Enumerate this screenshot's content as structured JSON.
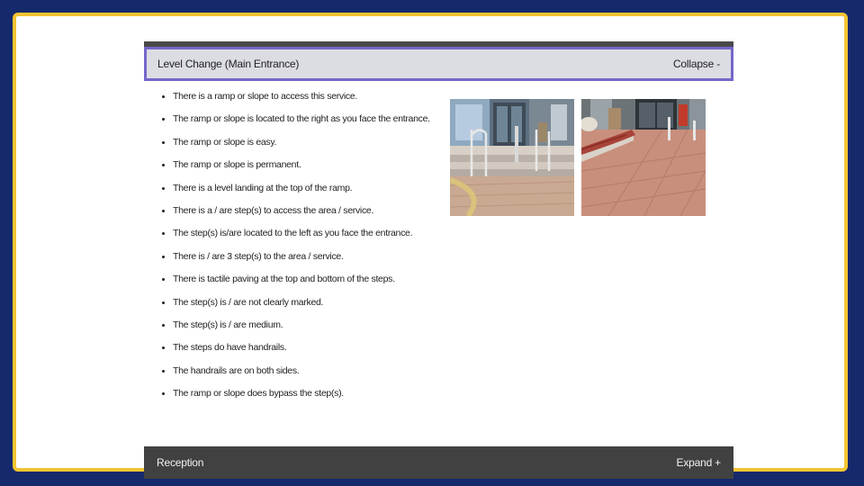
{
  "level_change": {
    "title": "Level Change (Main Entrance)",
    "toggle_label": "Collapse -",
    "items": [
      "There is a ramp or slope to access this service.",
      "The ramp or slope is located to the right as you face the entrance.",
      "The ramp or slope is easy.",
      "The ramp or slope is permanent.",
      "There is a level landing at the top of the ramp.",
      "There is a / are step(s) to access the area / service.",
      "The step(s) is/are located to the left as you face the entrance.",
      "There is / are 3 step(s) to the area / service.",
      "There is tactile paving at the top and bottom of the steps.",
      "The step(s) is / are not clearly marked.",
      "The step(s) is / are medium.",
      "The steps do have handrails.",
      "The handrails are on both sides.",
      "The ramp or slope does bypass the step(s)."
    ]
  },
  "reception": {
    "title": "Reception",
    "toggle_label": "Expand +"
  },
  "colors": {
    "background": "#16296b",
    "frame_border": "#f2c431",
    "active_header_bg": "#dcdce3",
    "active_header_border": "#7467c9",
    "collapsed_header_bg": "#414141"
  }
}
